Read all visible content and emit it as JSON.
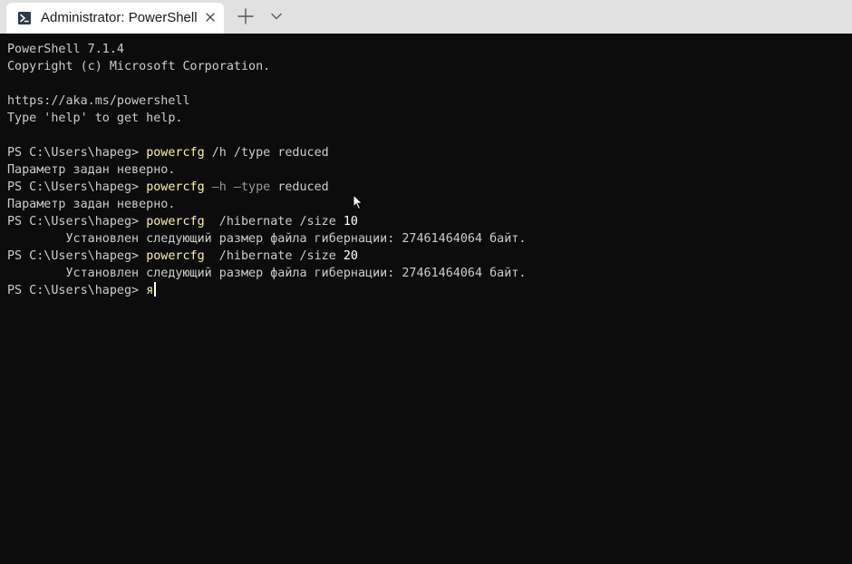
{
  "tab": {
    "title": "Administrator: PowerShell",
    "icon": "powershell-icon"
  },
  "tabbar": {
    "new_tab_icon": "plus-icon",
    "dropdown_icon": "chevron-down-icon"
  },
  "terminal": {
    "lines": [
      {
        "text": "PowerShell 7.1.4"
      },
      {
        "text": "Copyright (c) Microsoft Corporation."
      },
      {
        "text": ""
      },
      {
        "text": "https://aka.ms/powershell"
      },
      {
        "text": "Type 'help' to get help."
      },
      {
        "text": ""
      },
      {
        "prompt": "PS C:\\Users\\hapeg> ",
        "cmd": "powercfg",
        "args": [
          {
            "t": " /h /type ",
            "c": "plain"
          },
          {
            "t": "reduced",
            "c": "plain"
          }
        ]
      },
      {
        "text": "Параметр задан неверно."
      },
      {
        "prompt": "PS C:\\Users\\hapeg> ",
        "cmd": "powercfg",
        "args": [
          {
            "t": " –h –type ",
            "c": "param"
          },
          {
            "t": "reduced",
            "c": "plain"
          }
        ]
      },
      {
        "text": "Параметр задан неверно."
      },
      {
        "prompt": "PS C:\\Users\\hapeg> ",
        "cmd": "powercfg",
        "args": [
          {
            "t": "  /hibernate /size ",
            "c": "plain"
          },
          {
            "t": "10",
            "c": "num"
          }
        ]
      },
      {
        "text": "        Установлен следующий размер файла гибернации: 27461464064 байт."
      },
      {
        "prompt": "PS C:\\Users\\hapeg> ",
        "cmd": "powercfg",
        "args": [
          {
            "t": "  /hibernate /size ",
            "c": "plain"
          },
          {
            "t": "20",
            "c": "num"
          }
        ]
      },
      {
        "text": "        Установлен следующий размер файла гибернации: 27461464064 байт."
      },
      {
        "prompt": "PS C:\\Users\\hapeg> ",
        "cmd": "я",
        "args": [],
        "cursor": true
      }
    ]
  },
  "colors": {
    "background": "#0c0c0c",
    "foreground": "#cccccc",
    "command": "#f9f1a5",
    "parameter": "#9a9a9a",
    "number": "#ffffff",
    "tabbar": "#e1e1e1"
  }
}
